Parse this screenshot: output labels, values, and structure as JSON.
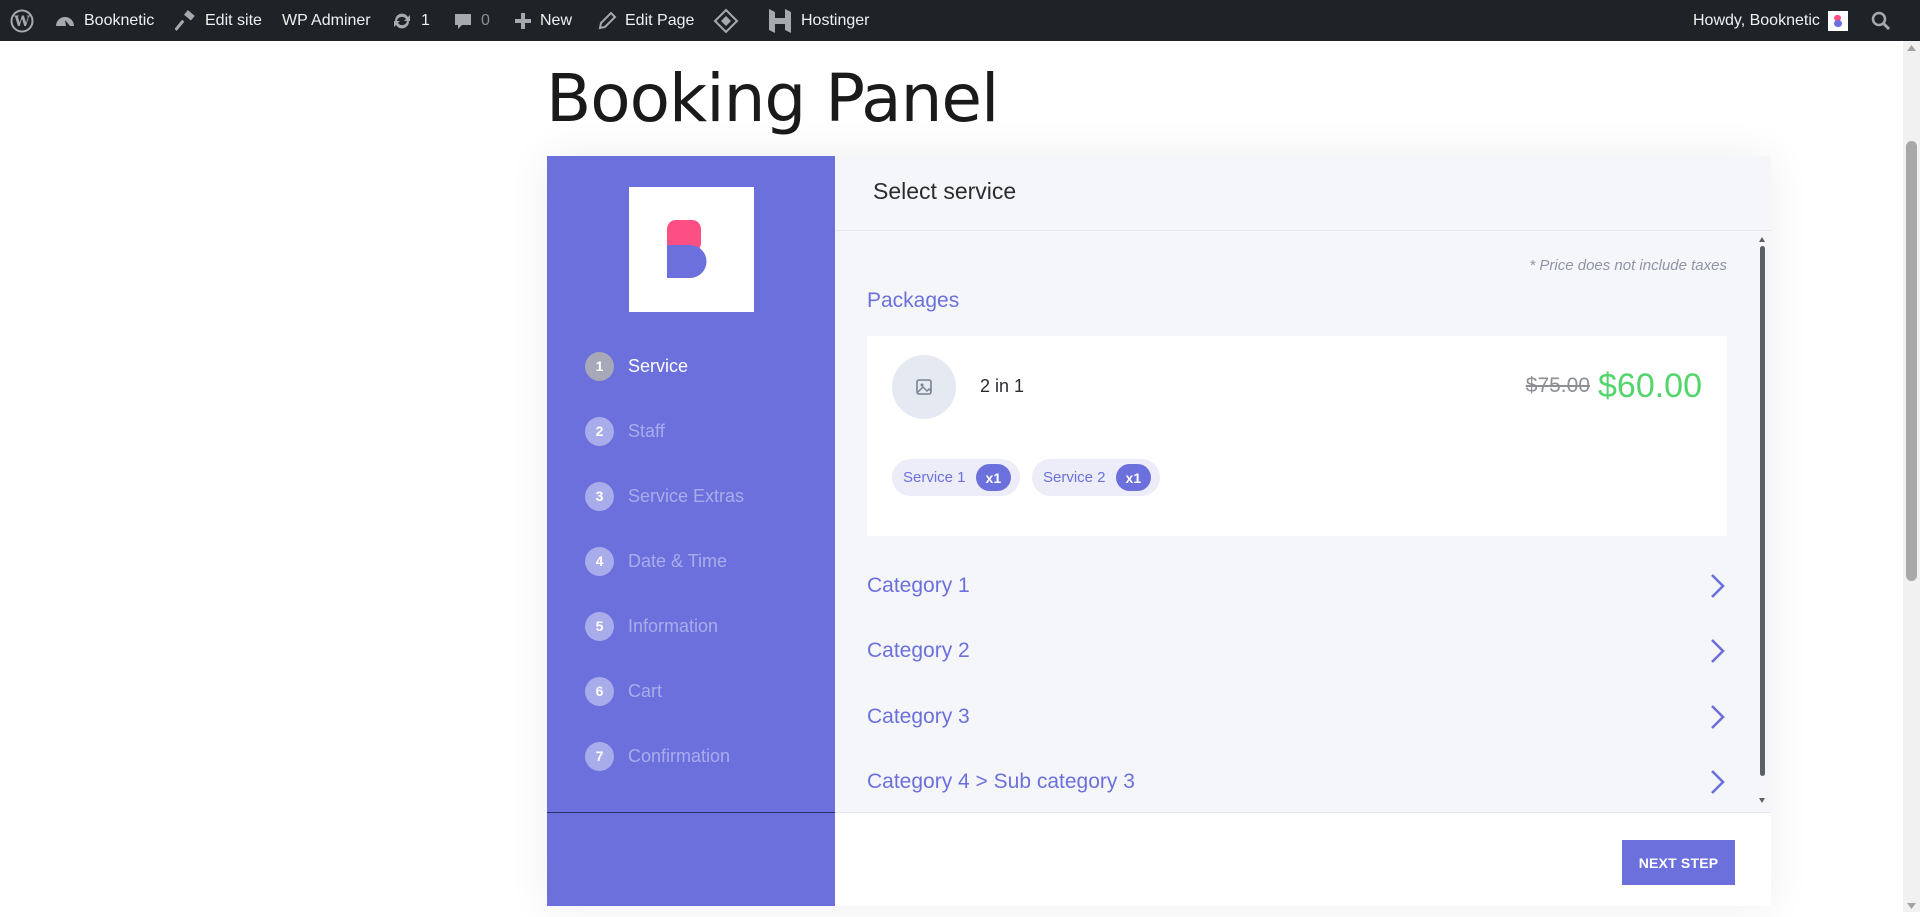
{
  "admin_bar": {
    "site_name": "Booknetic",
    "edit_site": "Edit site",
    "wp_adminer": "WP Adminer",
    "updates_count": "1",
    "comments_count": "0",
    "new_label": "New",
    "edit_page": "Edit Page",
    "hostinger": "Hostinger",
    "howdy": "Howdy, Booknetic"
  },
  "page": {
    "title": "Booking Panel"
  },
  "sidebar": {
    "steps": [
      {
        "num": "1",
        "label": "Service"
      },
      {
        "num": "2",
        "label": "Staff"
      },
      {
        "num": "3",
        "label": "Service Extras"
      },
      {
        "num": "4",
        "label": "Date & Time"
      },
      {
        "num": "5",
        "label": "Information"
      },
      {
        "num": "6",
        "label": "Cart"
      },
      {
        "num": "7",
        "label": "Confirmation"
      }
    ],
    "active_step": 1
  },
  "main": {
    "title": "Select service",
    "price_note": "* Price does not include taxes",
    "packages_title": "Packages",
    "package": {
      "name": "2 in 1",
      "old_price": "$75.00",
      "price": "$60.00",
      "services": [
        {
          "label": "Service 1",
          "qty": "x1"
        },
        {
          "label": "Service 2",
          "qty": "x1"
        }
      ]
    },
    "categories": [
      {
        "label": "Category 1"
      },
      {
        "label": "Category 2"
      },
      {
        "label": "Category 3"
      },
      {
        "label": "Category 4 > Sub category 3"
      }
    ],
    "next_button": "NEXT STEP"
  },
  "colors": {
    "accent": "#6c70dc",
    "price_green": "#53d56c",
    "admin_bar_bg": "#1d2327",
    "logo_pink": "#fc4f84"
  }
}
